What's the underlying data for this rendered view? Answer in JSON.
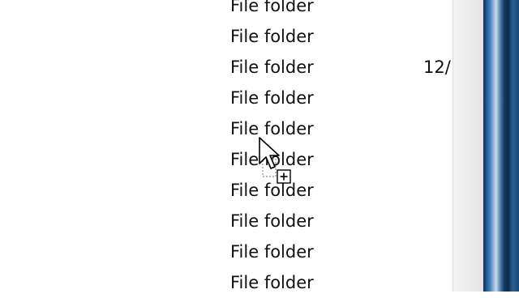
{
  "file_list": {
    "rows": [
      {
        "type": "File folder",
        "date": ""
      },
      {
        "type": "File folder",
        "date": ""
      },
      {
        "type": "File folder",
        "date": "12/"
      },
      {
        "type": "File folder",
        "date": ""
      },
      {
        "type": "File folder",
        "date": ""
      },
      {
        "type": "File folder",
        "date": ""
      },
      {
        "type": "File folder",
        "date": ""
      },
      {
        "type": "File folder",
        "date": ""
      },
      {
        "type": "File folder",
        "date": ""
      },
      {
        "type": "File folder",
        "date": ""
      }
    ]
  },
  "cursor": {
    "icon": "drag-copy-cursor-icon"
  }
}
